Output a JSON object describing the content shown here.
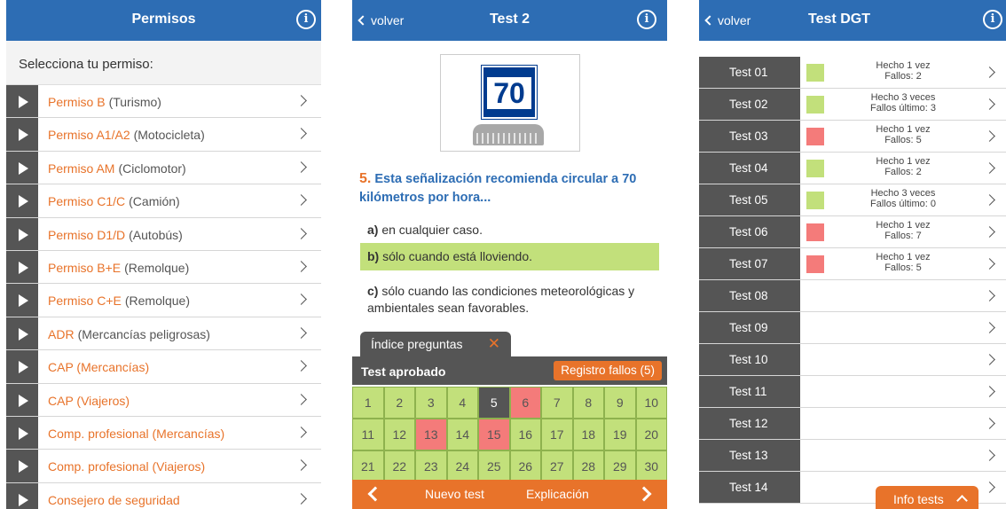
{
  "panel1": {
    "title": "Permisos",
    "info_icon": "i",
    "select_label": "Selecciona tu permiso:",
    "items": [
      {
        "label": "Permiso B",
        "sub": "(Turismo)"
      },
      {
        "label": "Permiso A1/A2",
        "sub": "(Motocicleta)"
      },
      {
        "label": "Permiso AM",
        "sub": "(Ciclomotor)"
      },
      {
        "label": "Permiso C1/C",
        "sub": "(Camión)"
      },
      {
        "label": "Permiso D1/D",
        "sub": "(Autobús)"
      },
      {
        "label": "Permiso B+E",
        "sub": "(Remolque)"
      },
      {
        "label": "Permiso C+E",
        "sub": "(Remolque)"
      },
      {
        "label": "ADR",
        "sub": "(Mercancías peligrosas)"
      },
      {
        "label": "CAP (Mercancías)",
        "sub": ""
      },
      {
        "label": "CAP (Viajeros)",
        "sub": ""
      },
      {
        "label": "Comp. profesional (Mercancías)",
        "sub": ""
      },
      {
        "label": "Comp. profesional (Viajeros)",
        "sub": ""
      },
      {
        "label": "Consejero de seguridad",
        "sub": ""
      }
    ]
  },
  "panel2": {
    "back": "volver",
    "title": "Test 2",
    "info_icon": "i",
    "sign_value": "70",
    "question_number": "5.",
    "question_text": "Esta señalización recomienda circular a 70 kilómetros por hora...",
    "answers": [
      {
        "letter": "a)",
        "text": "en cualquier caso."
      },
      {
        "letter": "b)",
        "text": "sólo cuando está lloviendo."
      },
      {
        "letter": "c)",
        "text": "sólo cuando las condiciones meteorológicas y ambientales sean favorables."
      }
    ],
    "index_tab": "Índice preguntas",
    "close_symbol": "✕",
    "result": "Test aprobado",
    "errors_button": "Registro fallos (5)",
    "question_grid": [
      {
        "n": "1",
        "state": "ok"
      },
      {
        "n": "2",
        "state": "ok"
      },
      {
        "n": "3",
        "state": "ok"
      },
      {
        "n": "4",
        "state": "ok"
      },
      {
        "n": "5",
        "state": "current"
      },
      {
        "n": "6",
        "state": "fail"
      },
      {
        "n": "7",
        "state": "ok"
      },
      {
        "n": "8",
        "state": "ok"
      },
      {
        "n": "9",
        "state": "ok"
      },
      {
        "n": "10",
        "state": "ok"
      },
      {
        "n": "11",
        "state": "ok"
      },
      {
        "n": "12",
        "state": "ok"
      },
      {
        "n": "13",
        "state": "fail"
      },
      {
        "n": "14",
        "state": "ok"
      },
      {
        "n": "15",
        "state": "fail"
      },
      {
        "n": "16",
        "state": "ok"
      },
      {
        "n": "17",
        "state": "ok"
      },
      {
        "n": "18",
        "state": "ok"
      },
      {
        "n": "19",
        "state": "ok"
      },
      {
        "n": "20",
        "state": "ok"
      },
      {
        "n": "21",
        "state": "ok"
      },
      {
        "n": "22",
        "state": "ok"
      },
      {
        "n": "23",
        "state": "ok"
      },
      {
        "n": "24",
        "state": "ok"
      },
      {
        "n": "25",
        "state": "ok"
      },
      {
        "n": "26",
        "state": "ok"
      },
      {
        "n": "27",
        "state": "ok"
      },
      {
        "n": "28",
        "state": "ok"
      },
      {
        "n": "29",
        "state": "ok"
      },
      {
        "n": "30",
        "state": "ok"
      }
    ],
    "bottom": {
      "new_test": "Nuevo test",
      "explanation": "Explicación"
    }
  },
  "panel3": {
    "back": "volver",
    "title": "Test DGT",
    "info_icon": "i",
    "tests": [
      {
        "name": "Test 01",
        "status": "green",
        "line1": "Hecho 1 vez",
        "line2": "Fallos: 2"
      },
      {
        "name": "Test 02",
        "status": "green",
        "line1": "Hecho 3 veces",
        "line2": "Fallos último: 3"
      },
      {
        "name": "Test 03",
        "status": "red",
        "line1": "Hecho 1 vez",
        "line2": "Fallos: 5"
      },
      {
        "name": "Test 04",
        "status": "green",
        "line1": "Hecho 1 vez",
        "line2": "Fallos: 2"
      },
      {
        "name": "Test 05",
        "status": "green",
        "line1": "Hecho 3 veces",
        "line2": "Fallos último: 0"
      },
      {
        "name": "Test 06",
        "status": "red",
        "line1": "Hecho 1 vez",
        "line2": "Fallos: 7"
      },
      {
        "name": "Test 07",
        "status": "red",
        "line1": "Hecho 1 vez",
        "line2": "Fallos: 5"
      },
      {
        "name": "Test 08",
        "status": "",
        "line1": "",
        "line2": ""
      },
      {
        "name": "Test 09",
        "status": "",
        "line1": "",
        "line2": ""
      },
      {
        "name": "Test 10",
        "status": "",
        "line1": "",
        "line2": ""
      },
      {
        "name": "Test 11",
        "status": "",
        "line1": "",
        "line2": ""
      },
      {
        "name": "Test 12",
        "status": "",
        "line1": "",
        "line2": ""
      },
      {
        "name": "Test 13",
        "status": "",
        "line1": "",
        "line2": ""
      },
      {
        "name": "Test 14",
        "status": "",
        "line1": "",
        "line2": ""
      }
    ],
    "info_tests": "Info tests"
  },
  "colors": {
    "header_blue": "#2d6db4",
    "accent_orange": "#e8732a",
    "ok_green": "#c2e07b",
    "fail_red": "#f47b7a",
    "dark_grey": "#555555"
  }
}
